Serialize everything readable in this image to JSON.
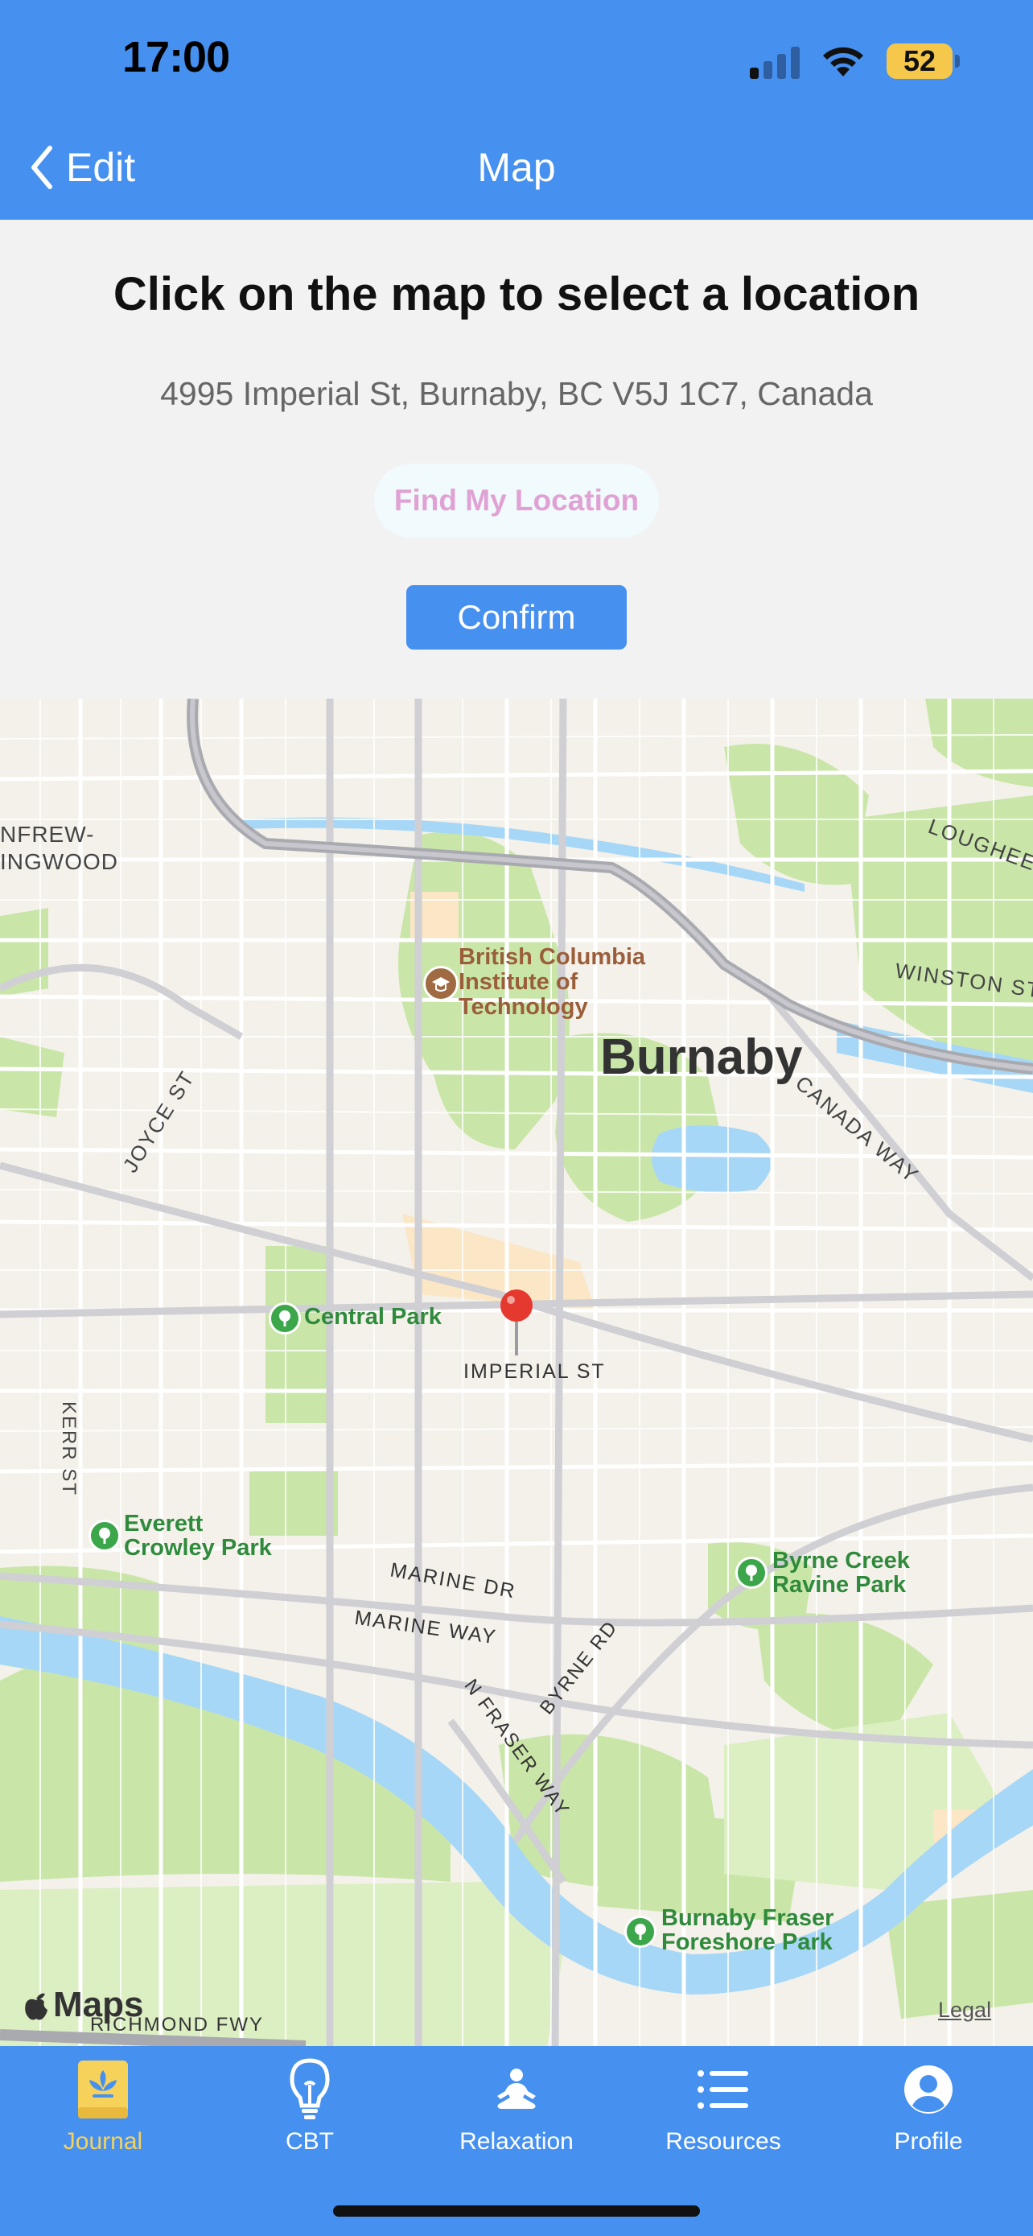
{
  "status_bar": {
    "time": "17:00",
    "battery": "52"
  },
  "nav": {
    "back_label": "Edit",
    "title": "Map"
  },
  "content": {
    "instruction": "Click on the map to select a location",
    "address": "4995 Imperial St, Burnaby, BC V5J 1C7, Canada",
    "find_location_label": "Find My Location",
    "confirm_label": "Confirm"
  },
  "map": {
    "labels": {
      "city": "Burnaby",
      "bcit": [
        "British Columbia",
        "Institute of",
        "Technology"
      ],
      "renfrew": [
        "NFREW-",
        "INGWOOD"
      ],
      "lougheed": "LOUGHEED",
      "winston": "WINSTON ST",
      "joyce": "JOYCE ST",
      "canada_way": "CANADA WAY",
      "central_park": "Central Park",
      "imperial": "IMPERIAL ST",
      "kerr": "KERR ST",
      "everett": [
        "Everett",
        "Crowley Park"
      ],
      "byrne_creek": [
        "Byrne Creek",
        "Ravine Park"
      ],
      "marine_dr": "MARINE DR",
      "marine_way": "MARINE WAY",
      "byrne_rd": "BYRNE RD",
      "fraser_way": "N FRASER WAY",
      "fraser_foreshore": [
        "Burnaby Fraser",
        "Foreshore Park"
      ],
      "richmond": "RICHMOND FWY",
      "maps_logo": "Maps",
      "legal": "Legal"
    }
  },
  "tabs": [
    {
      "label": "Journal",
      "icon": "journal-book-icon",
      "active": true
    },
    {
      "label": "CBT",
      "icon": "lightbulb-icon",
      "active": false
    },
    {
      "label": "Relaxation",
      "icon": "meditation-icon",
      "active": false
    },
    {
      "label": "Resources",
      "icon": "list-icon",
      "active": false
    },
    {
      "label": "Profile",
      "icon": "person-circle-icon",
      "active": false
    }
  ],
  "colors": {
    "header_blue": "#4690f0",
    "active_tab": "#f6d25b",
    "find_text": "#e0a2d4",
    "pin": "#e5392f"
  }
}
